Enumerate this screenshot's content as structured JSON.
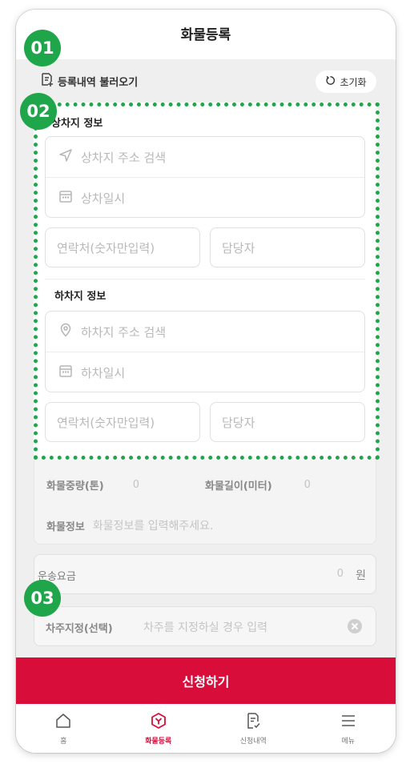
{
  "header": {
    "title": "화물등록"
  },
  "load_bar": {
    "load_label": "등록내역 불러오기",
    "reset_label": "초기화"
  },
  "badges": {
    "b1": "01",
    "b2": "02",
    "b3": "03"
  },
  "pickup": {
    "section_title": "상차지 정보",
    "address_placeholder": "상차지 주소 검색",
    "date_placeholder": "상차일시",
    "contact_placeholder": "연락처(숫자만입력)",
    "manager_placeholder": "담당자"
  },
  "dropoff": {
    "section_title": "하차지 정보",
    "address_placeholder": "하차지 주소 검색",
    "date_placeholder": "하차일시",
    "contact_placeholder": "연락처(숫자만입력)",
    "manager_placeholder": "담당자"
  },
  "cargo": {
    "weight_label": "화물중량(톤)",
    "weight_value": "0",
    "length_label": "화물길이(미터)",
    "length_value": "0",
    "info_label": "화물정보",
    "info_placeholder": "화물정보를 입력해주세요."
  },
  "fee": {
    "label": "운송요금",
    "value": "0",
    "unit": "원"
  },
  "driver": {
    "label": "차주지정(선택)",
    "placeholder": "차주를 지정하실 경우 입력"
  },
  "submit": {
    "label": "신청하기"
  },
  "tabbar": {
    "tabs": [
      {
        "label": "홈"
      },
      {
        "label": "화물등록"
      },
      {
        "label": "신청내역"
      },
      {
        "label": "메뉴"
      }
    ]
  },
  "colors": {
    "accent": "#d90d3a",
    "annotation": "#1fa64a"
  }
}
